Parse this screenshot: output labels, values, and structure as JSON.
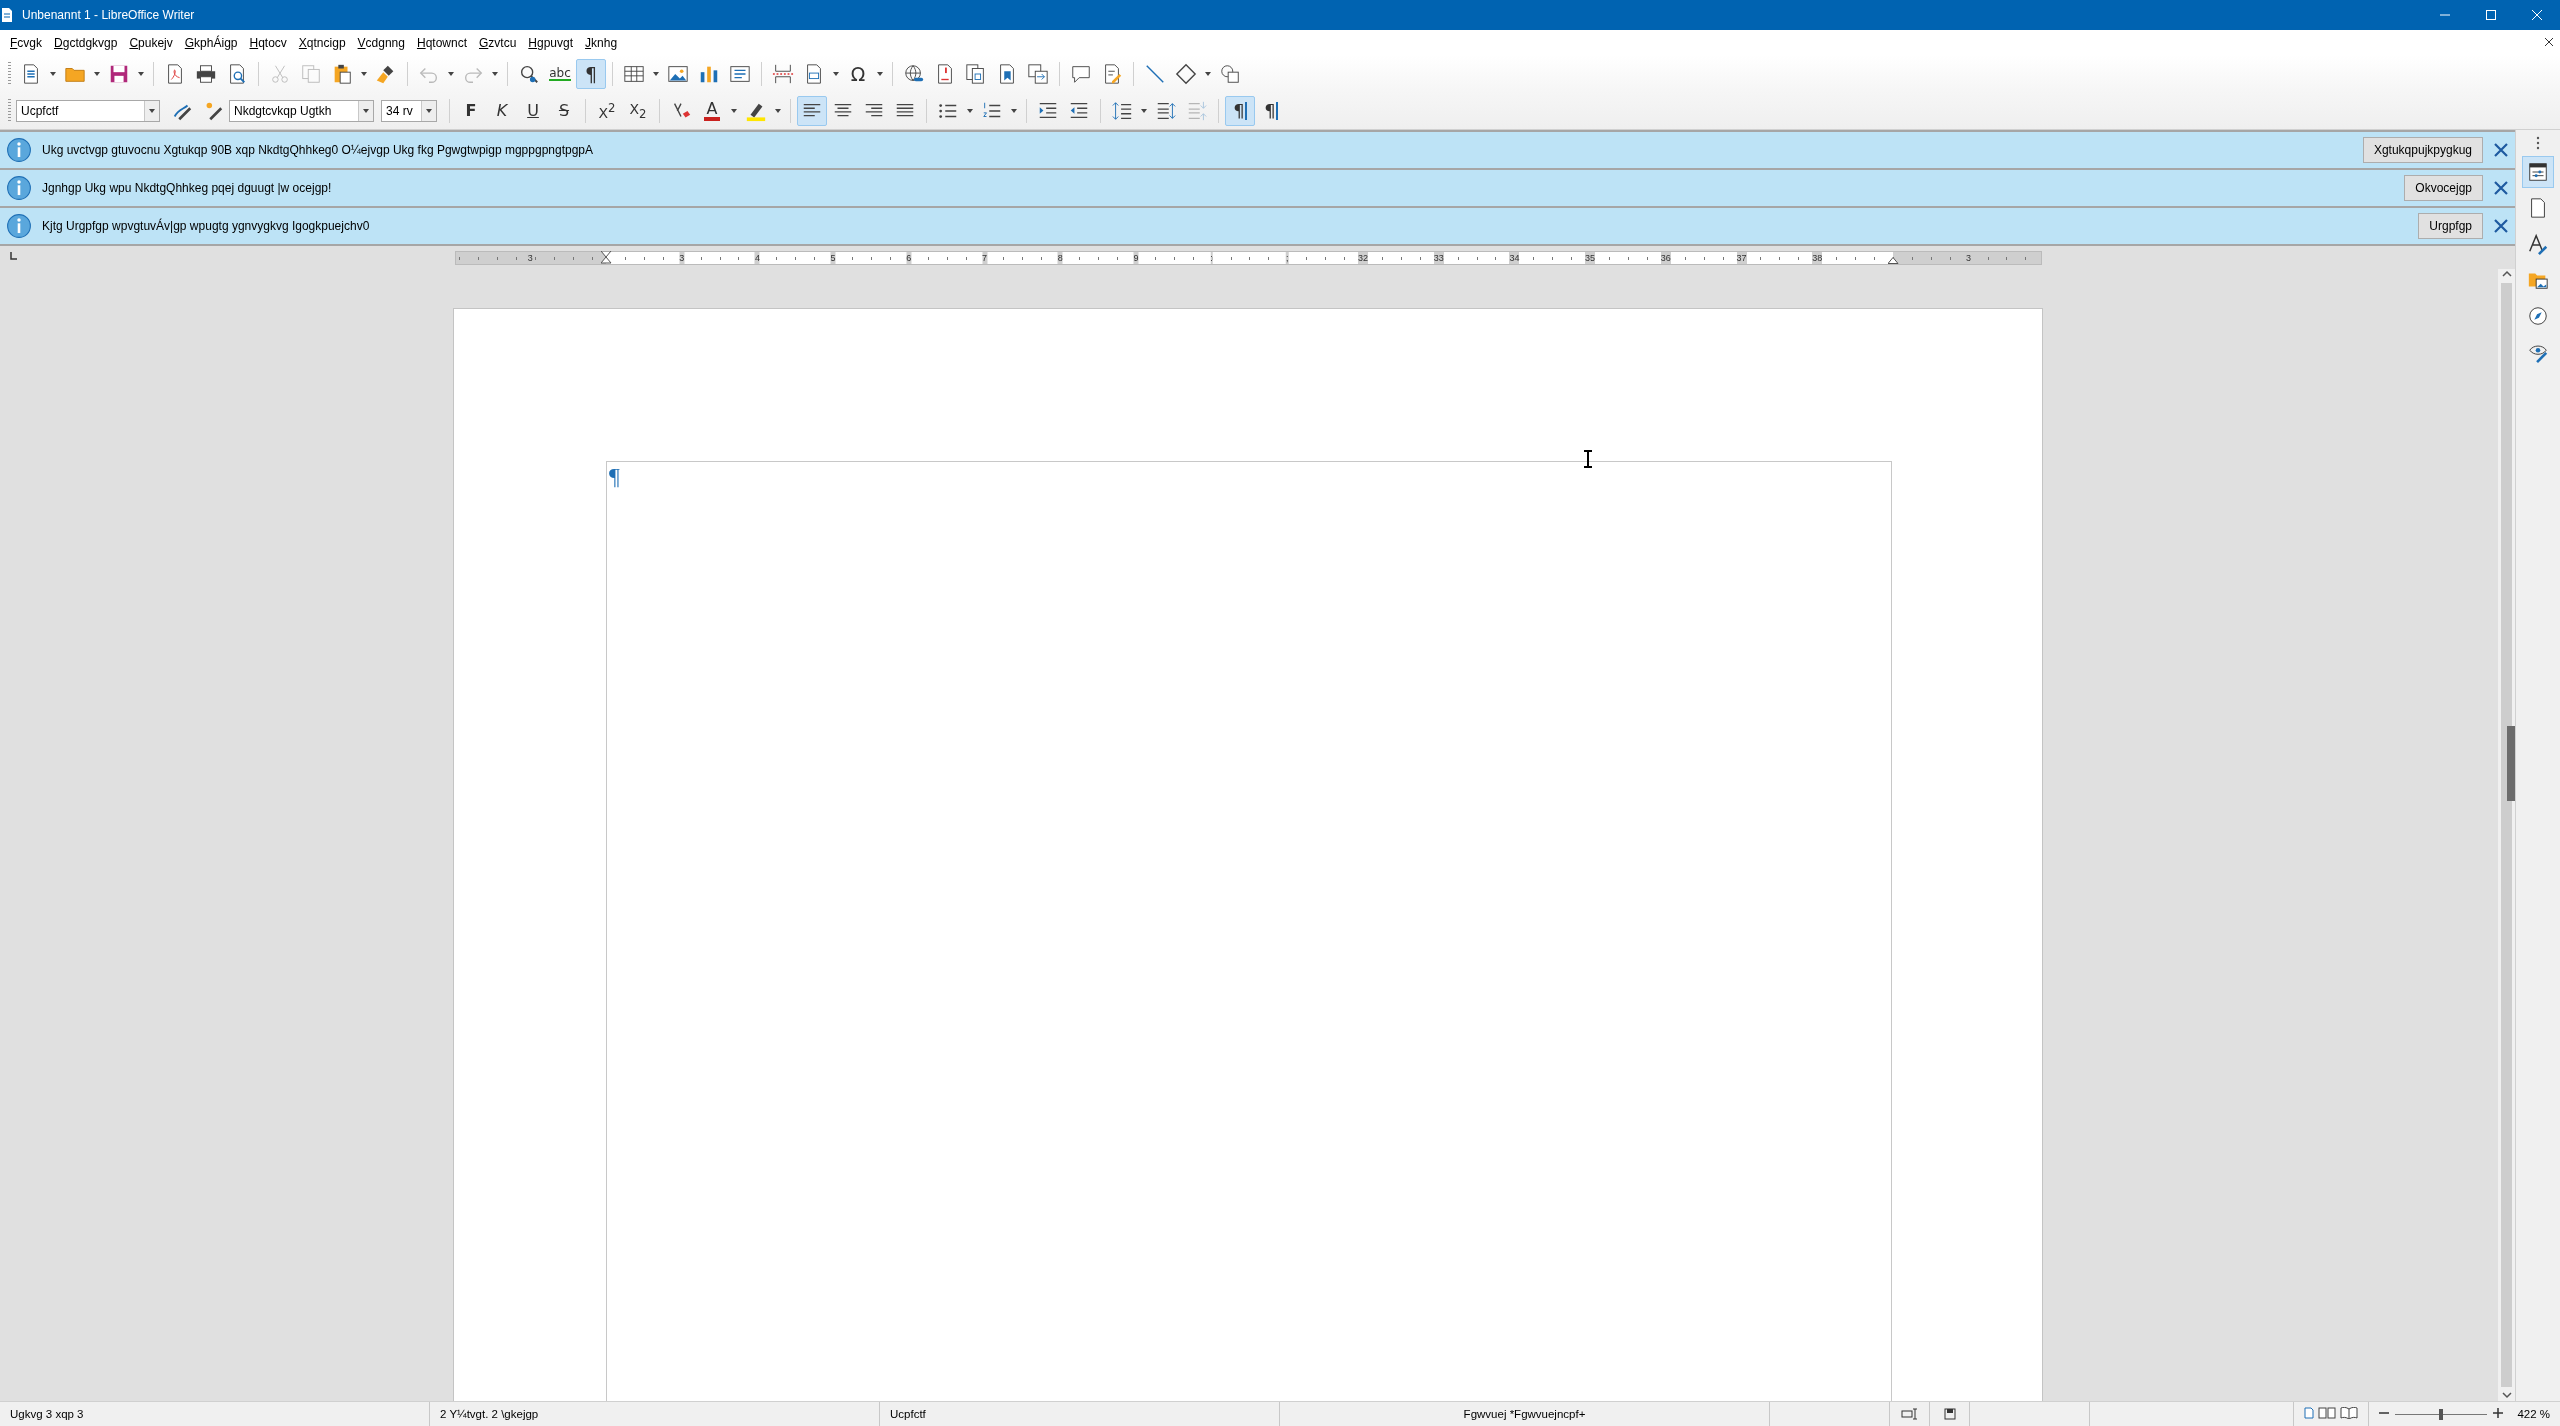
{
  "window": {
    "title": "Unbenannt 1 - LibreOffice Writer"
  },
  "menu": [
    "Fcvgk",
    "Dgctdgkvgp",
    "Cpukejv",
    "GkphÁigp",
    "Hqtocv",
    "Xqtncigp",
    "Vcdgnng",
    "Hqtownct",
    "Gzvtcu",
    "Hgpuvgt",
    "Jknhg"
  ],
  "standard_toolbar": {
    "cut": {
      "disabled": true
    },
    "copy": {
      "disabled": true
    },
    "undo": {
      "disabled": true
    },
    "redo": {
      "disabled": true
    },
    "spelling": "abc",
    "formatting_marks": {
      "glyph": "¶",
      "on": true
    },
    "special_character": "Ω"
  },
  "formatting_toolbar": {
    "paragraph_style": "Ucpfctf",
    "font_name": "Nkdgtcvkqp Ugtkh",
    "font_size": "34 rv",
    "bold": "F",
    "italic": "K",
    "underline": "U",
    "strikethrough": "S",
    "superscript": "X$^{2}$",
    "subscript": "X$_{2}$",
    "font_color": "A",
    "alignment": [
      {
        "selected": true
      },
      {
        "selected": false
      },
      {
        "selected": false
      },
      {
        "selected": false
      }
    ],
    "decrease_paragraph_spacing": {
      "disabled": true
    },
    "left_to_right": {
      "glyph": "¶",
      "on": true
    },
    "right_to_left": {
      "glyph": "¶",
      "on": false
    }
  },
  "infobars": [
    {
      "message": "Ukg uvctvgp gtuvocnu Xgtukqp 90B xqp NkdtgQhhkeg0 O¼ejvgp Ukg fkg Pgwgtwpigp mgppgpngtpgpA",
      "button": "Xgtukqpujkpygkug"
    },
    {
      "message": "Jgnhgp Ukg wpu NkdtgQhhkeg pqej dguugt |w ocejgp!",
      "button": "Okvocejgp"
    },
    {
      "message": "Kjtg Urgpfgp wpvgtuvÁv|gp wpugtg ygnvygkvg Igogkpuejchv0",
      "button": "Urgpfgp"
    }
  ],
  "ruler": {
    "labels": [
      "3",
      "3",
      "4",
      "5",
      "6",
      "7",
      "8",
      "9",
      ":",
      ";",
      "32",
      "33",
      "34",
      "35",
      "36",
      "37",
      "38",
      "3"
    ]
  },
  "document": {
    "paragraph_mark": "¶"
  },
  "sidebar_tabs": [
    {
      "selected": true
    },
    {
      "selected": false
    },
    {
      "selected": false
    },
    {
      "selected": false
    },
    {
      "selected": false
    },
    {
      "selected": false
    }
  ],
  "status_bar": {
    "page": "Ugkvg 3 xqp 3",
    "word_count": "2 Y¼tvgt. 2 \\gkejgp",
    "page_style": "Ucpfctf",
    "language": "Fgwvuej *Fgwvuejncpf+",
    "zoom": {
      "level": 0.5,
      "reading": "422 %"
    }
  }
}
